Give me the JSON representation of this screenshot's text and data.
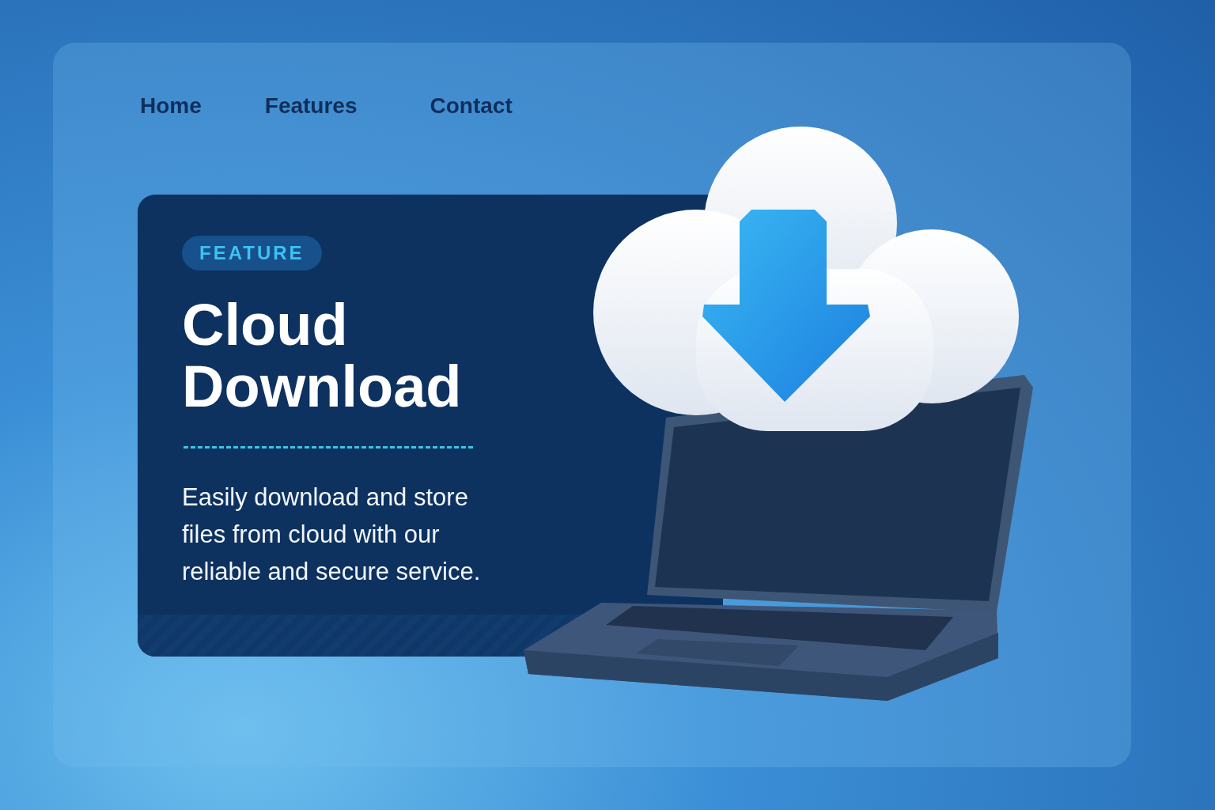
{
  "nav": [
    {
      "label": "Home"
    },
    {
      "label": "Features"
    },
    {
      "label": "Contact"
    }
  ],
  "hero": {
    "badge": "FEATURE",
    "title": "Cloud Download",
    "description": "Easily download and store files from cloud with our reliable and secure service."
  }
}
